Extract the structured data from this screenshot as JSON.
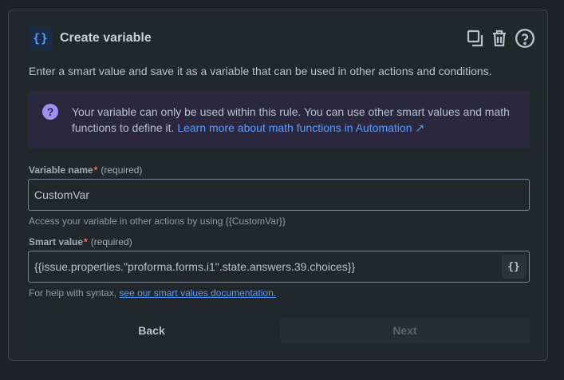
{
  "header": {
    "icon_glyph": "{}",
    "title": "Create variable",
    "actions": [
      {
        "name": "duplicate-icon"
      },
      {
        "name": "trash-icon"
      },
      {
        "name": "help-icon"
      }
    ]
  },
  "description": "Enter a smart value and save it as a variable that can be used in other actions and conditions.",
  "info": {
    "icon_glyph": "?",
    "text": "Your variable can only be used within this rule. You can use other smart values and math functions to define it.",
    "link_text": "Learn more about math functions in Automation",
    "link_arrow": "↗"
  },
  "variable_name": {
    "label": "Variable name",
    "required_mark": "*",
    "required_text": "(required)",
    "value": "CustomVar",
    "helper": "Access your variable in other actions by using {{CustomVar}}"
  },
  "smart_value": {
    "label": "Smart value",
    "required_mark": "*",
    "required_text": "(required)",
    "value": "{{issue.properties.\"proforma.forms.i1\".state.answers.39.choices}}",
    "insert_button_glyph": "{}",
    "helper_prefix": "For help with syntax,",
    "helper_link": "see our smart values documentation."
  },
  "footer": {
    "back_label": "Back",
    "next_label": "Next"
  },
  "colors": {
    "background": "#1d2125",
    "panel": "#22272b",
    "accent": "#579dff",
    "info_bg": "#2b273f",
    "info_icon": "#9f8fef",
    "required": "#f87168"
  }
}
